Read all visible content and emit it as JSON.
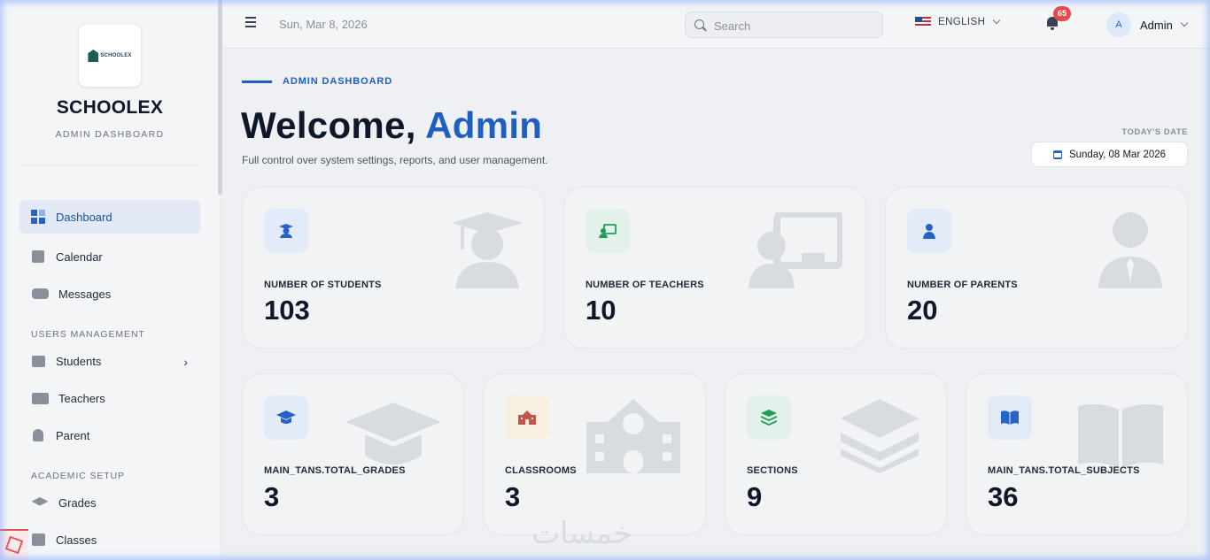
{
  "sidebar": {
    "brand": "SCHOOLEX",
    "logo_text": "SCHOOLEX",
    "subtitle": "ADMIN DASHBOARD",
    "items": {
      "dashboard": "Dashboard",
      "calendar": "Calendar",
      "messages": "Messages",
      "students": "Students",
      "teachers": "Teachers",
      "parent": "Parent",
      "grades": "Grades",
      "classes": "Classes"
    },
    "sections": {
      "users": "USERS MANAGEMENT",
      "academic": "ACADEMIC SETUP"
    }
  },
  "header": {
    "date": "Sun, Mar 8, 2026",
    "search_placeholder": "Search",
    "language": "ENGLISH",
    "notifications_count": "65",
    "user_initial": "A",
    "user_name": "Admin"
  },
  "main": {
    "eyebrow": "ADMIN DASHBOARD",
    "welcome_prefix": "Welcome, ",
    "welcome_name": "Admin",
    "subtitle": "Full control over system settings, reports, and user management.",
    "today_label": "TODAY'S DATE",
    "today_value": "Sunday, 08 Mar 2026",
    "stats_top": [
      {
        "label": "NUMBER OF STUDENTS",
        "value": "103"
      },
      {
        "label": "NUMBER OF TEACHERS",
        "value": "10"
      },
      {
        "label": "NUMBER OF PARENTS",
        "value": "20"
      }
    ],
    "stats_bottom": [
      {
        "label": "MAIN_TANS.TOTAL_GRADES",
        "value": "3"
      },
      {
        "label": "CLASSROOMS",
        "value": "3"
      },
      {
        "label": "SECTIONS",
        "value": "9"
      },
      {
        "label": "MAIN_TANS.TOTAL_SUBJECTS",
        "value": "36"
      }
    ],
    "watermark": "خمسات"
  },
  "colors": {
    "accent": "#1e5fbf",
    "badge": "#e74a4a",
    "teacher_icon_bg": "#e3f1ea",
    "classroom_icon_bg": "#f7efe0",
    "section_icon_bg": "#e3f1ea",
    "blue_icon_bg": "#e3ebf8"
  }
}
